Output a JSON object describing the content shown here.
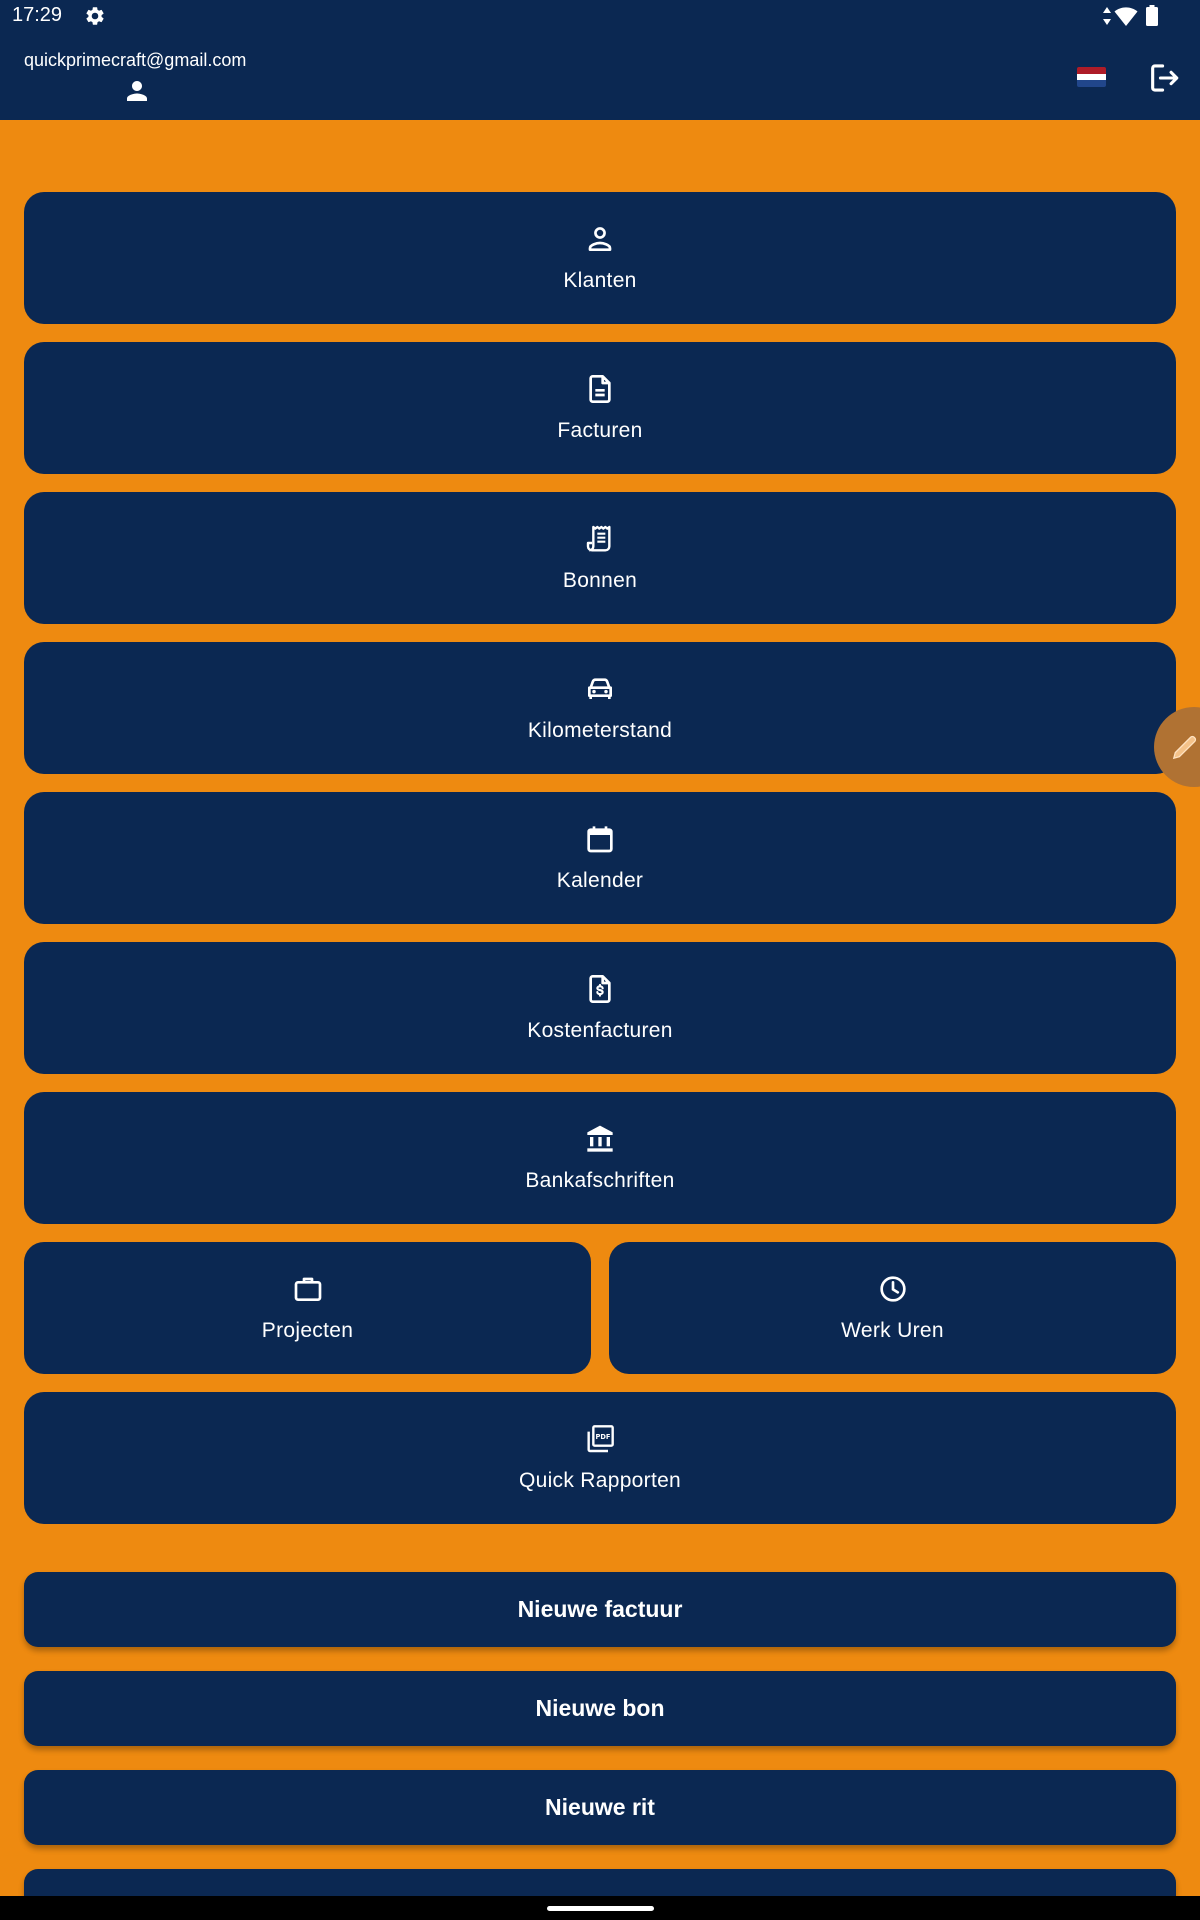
{
  "status_bar": {
    "time": "17:29",
    "icons": [
      "settings-gear-icon",
      "data-arrows-icon",
      "wifi-icon",
      "battery-icon"
    ]
  },
  "header": {
    "user_email": "quickprimecraft@gmail.com",
    "avatar_icon": "person-icon",
    "language_flag": "flag-nl-icon",
    "flag_colors": [
      "#AE1C28",
      "#FFFFFF",
      "#21468B"
    ],
    "logout_icon": "logout-icon"
  },
  "menu_tiles": [
    {
      "label": "Klanten",
      "icon": "person-outline-icon"
    },
    {
      "label": "Facturen",
      "icon": "document-icon"
    },
    {
      "label": "Bonnen",
      "icon": "receipt-icon"
    },
    {
      "label": "Kilometerstand",
      "icon": "car-icon"
    },
    {
      "label": "Kalender",
      "icon": "calendar-icon"
    },
    {
      "label": "Kostenfacturen",
      "icon": "invoice-dollar-icon"
    },
    {
      "label": "Bankafschriften",
      "icon": "bank-icon"
    },
    {
      "label": "Projecten",
      "icon": "briefcase-icon"
    },
    {
      "label": "Werk Uren",
      "icon": "clock-icon"
    },
    {
      "label": "Quick Rapporten",
      "icon": "pdf-icon"
    }
  ],
  "actions": {
    "new_invoice": "Nieuwe factuur",
    "new_receipt": "Nieuwe bon",
    "new_trip": "Nieuwe rit"
  },
  "floating_button_icon": "pencil-icon",
  "colors": {
    "background": "#EE8A10",
    "primary": "#0B2852",
    "text": "#FFFFFF",
    "fab": "#B07233"
  }
}
